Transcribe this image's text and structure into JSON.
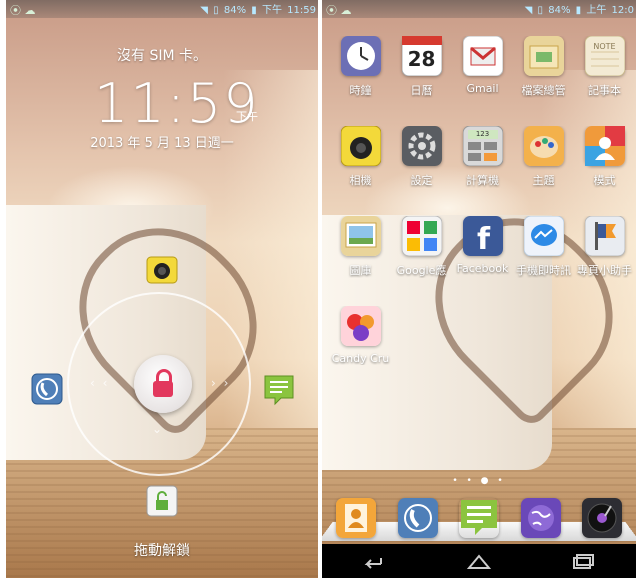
{
  "lock_screen": {
    "status": {
      "wifi": "wifi-icon",
      "battery_text": "84%",
      "ampm": "下午",
      "time": "11:59"
    },
    "carrier": "沒有 SIM 卡。",
    "clock": {
      "time": "11:59",
      "ampm": "下午"
    },
    "date": "2013 年 5 月 13 日週一",
    "unlock_hint": "拖動解鎖",
    "targets": [
      "camera-icon",
      "phone-icon",
      "messaging-icon",
      "unlock-icon"
    ]
  },
  "home_screen": {
    "status": {
      "battery_text": "84%",
      "ampm": "上午",
      "time": "12:0"
    },
    "apps": [
      {
        "label": "時鐘",
        "icon": "clock-icon",
        "color": "#6c6fb5"
      },
      {
        "label": "日曆",
        "icon": "calendar-icon",
        "color": "#ffffff",
        "value": "28"
      },
      {
        "label": "Gmail",
        "icon": "gmail-icon",
        "color": "#ffffff"
      },
      {
        "label": "檔案總管",
        "icon": "folder-icon",
        "color": "#e9d49a"
      },
      {
        "label": "記事本",
        "icon": "notepad-icon",
        "color": "#f3ead4",
        "value": "NOTE"
      },
      {
        "label": "相機",
        "icon": "camera-icon",
        "color": "#f3d93a"
      },
      {
        "label": "設定",
        "icon": "settings-icon",
        "color": "#5a5d62"
      },
      {
        "label": "計算機",
        "icon": "calculator-icon",
        "color": "#d9d9d9",
        "value": "123"
      },
      {
        "label": "主題",
        "icon": "themes-icon",
        "color": "#f3b14b"
      },
      {
        "label": "模式",
        "icon": "mode-icon",
        "color": "#f09a3b"
      },
      {
        "label": "圖庫",
        "icon": "gallery-icon",
        "color": "#e9d49a"
      },
      {
        "label": "Google應",
        "icon": "google-apps-icon",
        "color": "#f4f4f4"
      },
      {
        "label": "Facebook",
        "icon": "facebook-icon",
        "color": "#3b5998"
      },
      {
        "label": "手機即時訊",
        "icon": "messenger-icon",
        "color": "#eef3fb"
      },
      {
        "label": "專頁小助手",
        "icon": "pages-manager-icon",
        "color": "#e9ecf1"
      },
      {
        "label": "Candy Cru",
        "icon": "candy-crush-icon",
        "color": "#ffd3da"
      }
    ],
    "dock": [
      {
        "icon": "contacts-icon",
        "color": "#f3a63a"
      },
      {
        "icon": "phone-icon",
        "color": "#4f7fb8"
      },
      {
        "icon": "messaging-icon",
        "color": "#8bc43f"
      },
      {
        "icon": "browser-icon",
        "color": "#6a48b8"
      },
      {
        "icon": "music-icon",
        "color": "#2d2d33"
      }
    ],
    "nav": [
      "back-icon",
      "home-icon",
      "recents-icon"
    ]
  }
}
